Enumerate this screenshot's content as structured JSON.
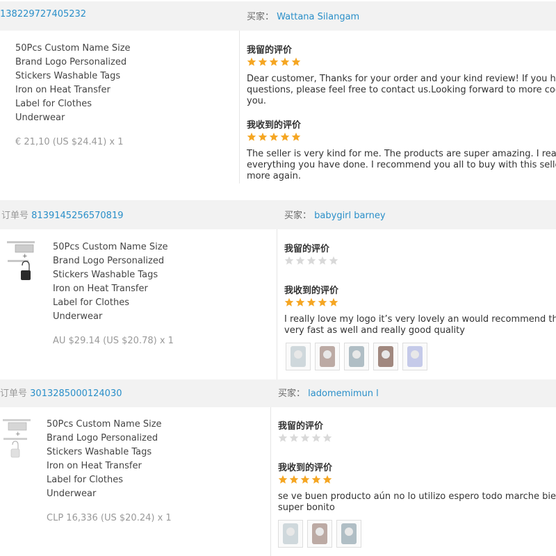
{
  "star_colors": {
    "filled": "#f5a623",
    "empty": "#d9d9d9"
  },
  "orders": [
    {
      "order_label": "",
      "order_number": "138229727405232",
      "buyer_label": "买家：",
      "buyer_name": "Wattana Silangam",
      "product": {
        "name_lines": [
          "50Pcs Custom Name Size",
          "Brand Logo Personalized",
          "Stickers Washable Tags",
          "Iron on Heat Transfer",
          "Label for Clothes",
          "Underwear"
        ],
        "price": "€ 21,10 (US $24.41) x 1"
      },
      "my_review": {
        "title": "我留的评价",
        "stars": 5,
        "text_lines": [
          "Dear customer, Thanks for your order and your kind review! If you had a",
          "questions, please feel free to contact us.Looking forward to more coope",
          "you."
        ]
      },
      "received_review": {
        "title": "我收到的评价",
        "stars": 5,
        "text_lines": [
          "The seller is very kind for me. The products are super amazing. I really a",
          "everything you have done. I recommend you all to buy with this seller. I",
          "more again."
        ],
        "photo_count": 0
      }
    },
    {
      "order_label": "订单号",
      "order_number": "8139145256570819",
      "buyer_label": "买家：",
      "buyer_name": "babygirl barney",
      "product": {
        "name_lines": [
          "50Pcs Custom Name Size",
          "Brand Logo Personalized",
          "Stickers Washable Tags",
          "Iron on Heat Transfer",
          "Label for Clothes",
          "Underwear"
        ],
        "price": "AU $29.14 (US $20.78) x 1"
      },
      "my_review": {
        "title": "我留的评价",
        "stars": 0,
        "text_lines": []
      },
      "received_review": {
        "title": "我收到的评价",
        "stars": 5,
        "text_lines": [
          "I really love my logo it’s very lovely an would recommend the",
          "very fast as well and really good quality"
        ],
        "photo_count": 5
      }
    },
    {
      "order_label": "订单号",
      "order_number": "3013285000124030",
      "buyer_label": "买家：",
      "buyer_name": "ladomemimun l",
      "product": {
        "name_lines": [
          "50Pcs Custom Name Size",
          "Brand Logo Personalized",
          "Stickers Washable Tags",
          "Iron on Heat Transfer",
          "Label for Clothes",
          "Underwear"
        ],
        "price": "CLP 16,336 (US $20.24) x 1"
      },
      "my_review": {
        "title": "我留的评价",
        "stars": 0,
        "text_lines": []
      },
      "received_review": {
        "title": "我收到的评价",
        "stars": 5,
        "text_lines": [
          "se ve buen producto aún no lo utilizo espero todo marche bien ,",
          "super bonito"
        ],
        "photo_count": 3
      }
    }
  ]
}
